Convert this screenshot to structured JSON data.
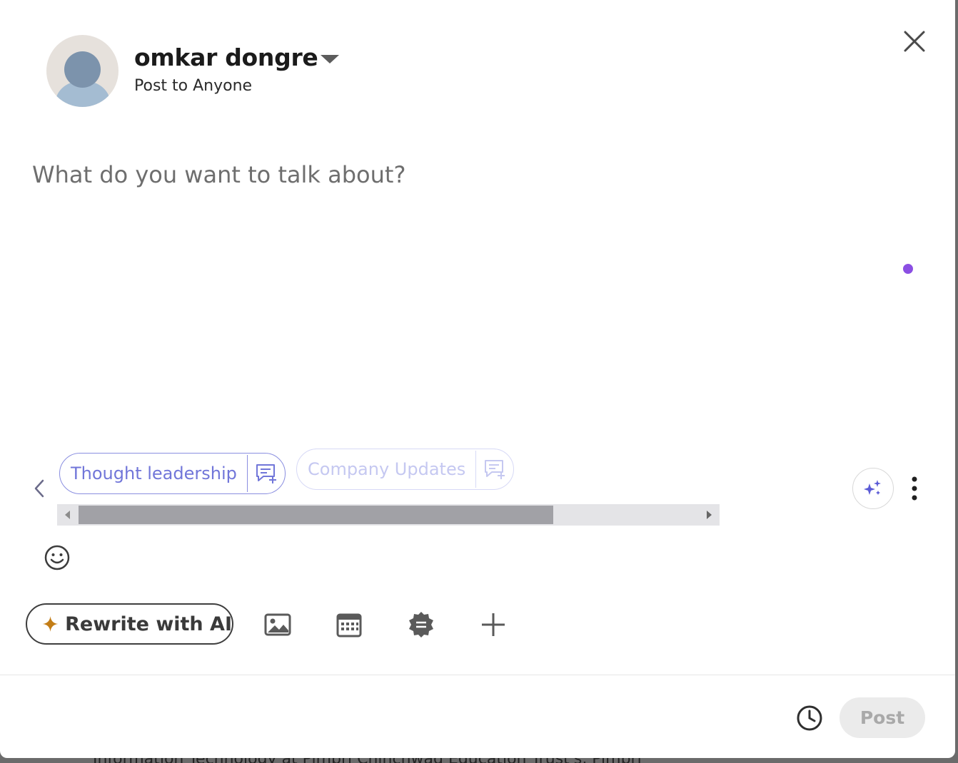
{
  "background_text": "Information Technology at Pimpri Chinchwad Education Trust's, Pimpri",
  "header": {
    "user_name": "omkar dongre",
    "visibility": "Post to Anyone"
  },
  "composer": {
    "placeholder": "What do you want to talk about?",
    "value": ""
  },
  "suggestion_chips": [
    {
      "label": "Thought leadership"
    },
    {
      "label": "Company Updates"
    }
  ],
  "toolbar": {
    "rewrite_label": "Rewrite with AI"
  },
  "footer": {
    "post_label": "Post"
  },
  "colors": {
    "accent": "#7176d9",
    "dot": "#8b4fe3",
    "sparkle": "#c37d16"
  },
  "icons": [
    "close-icon",
    "chevron-left-icon",
    "comment-plus-icon",
    "ai-sparkle-icon",
    "more-vertical-icon",
    "emoji-icon",
    "sparkle-icon",
    "image-icon",
    "calendar-icon",
    "badge-icon",
    "plus-icon",
    "clock-icon",
    "chevron-down-icon"
  ]
}
